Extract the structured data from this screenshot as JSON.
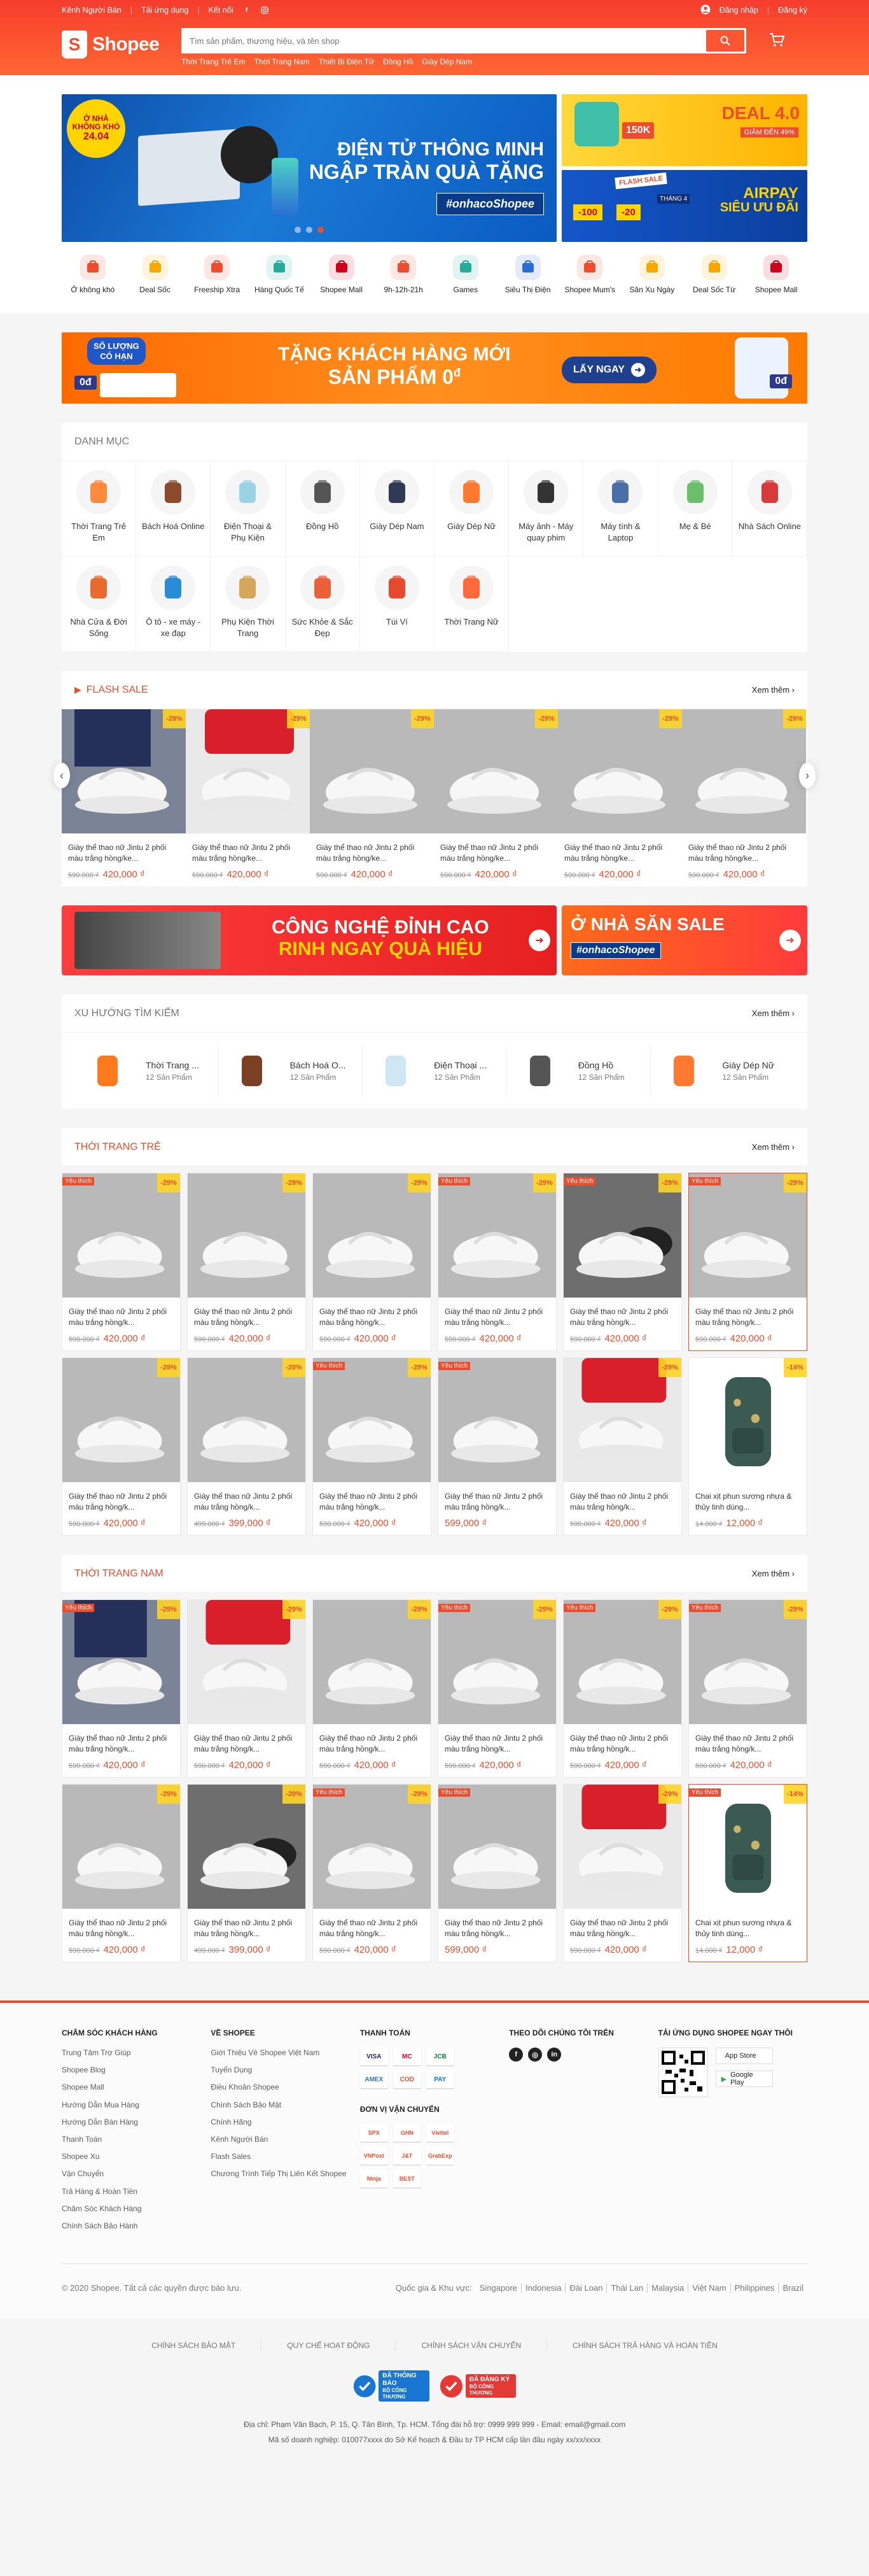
{
  "topbar": {
    "seller": "Kênh Người Bán",
    "download": "Tải ứng dụng",
    "connect": "Kết nối",
    "login": "Đăng nhập",
    "register": "Đăng ký"
  },
  "logo": {
    "text": "Shopee"
  },
  "search": {
    "placeholder": "Tìm sản phẩm, thương hiệu, và tên shop"
  },
  "hotwords": [
    "Thời Trang Trẻ Em",
    "Thời Trang Nam",
    "Thiết Bị Điện Tử",
    "Đồng Hồ",
    "Giày Dép Nam"
  ],
  "banner": {
    "badge_line1": "Ở NHÀ",
    "badge_line2": "KHÔNG KHÓ",
    "badge_date": "24.04",
    "headline1": "ĐIỆN TỬ THÔNG MINH",
    "headline2": "NGẬP TRÀN QUÀ TẶNG",
    "hashtag": "#onhacoShopee",
    "side1_title": "DEAL 4.0",
    "side1_sub": "GIẢM ĐẾN 49%",
    "side1_voucher": "150K",
    "side2_title1": "AIRPAY",
    "side2_title2": "SIÊU ƯU ĐÃI",
    "side2_tag": "THÁNG 4",
    "side2_v1": "-100",
    "side2_v2": "-20",
    "side2_flash": "FLASH SALE"
  },
  "quicklinks": [
    {
      "label": "Ở không khó",
      "icon": "home-icon",
      "color": "#ee4d2d"
    },
    {
      "label": "Deal Sốc",
      "icon": "deal-icon",
      "color": "#f6a700"
    },
    {
      "label": "Freeship Xtra",
      "icon": "truck-icon",
      "color": "#ee4d2d"
    },
    {
      "label": "Hàng Quốc Tế",
      "icon": "globe-icon",
      "color": "#26aa99"
    },
    {
      "label": "Shopee Mall",
      "icon": "mall-icon",
      "color": "#d0011b"
    },
    {
      "label": "9h-12h-21h",
      "icon": "flash-icon",
      "color": "#ee4d2d"
    },
    {
      "label": "Games",
      "icon": "gamepad-icon",
      "color": "#26aa99"
    },
    {
      "label": "Siêu Thị Điện",
      "icon": "monitor-icon",
      "color": "#2b6cd6"
    },
    {
      "label": "Shopee Mum's",
      "icon": "mums-club-icon",
      "color": "#ee4d2d"
    },
    {
      "label": "Săn Xu Ngày",
      "icon": "coin-icon",
      "color": "#f6a700"
    },
    {
      "label": "Deal Sốc Từ",
      "icon": "deal-icon",
      "color": "#f6a700"
    },
    {
      "label": "Shopee Mall",
      "icon": "mall-bag-icon",
      "color": "#d0011b"
    }
  ],
  "promo": {
    "left_label": "SỐ LƯỢNG",
    "left_label2": "CÓ HẠN",
    "price_tag": "0đ",
    "title1": "TẶNG KHÁCH HÀNG MỚI",
    "title2": "SẢN PHẨM 0",
    "title2_sup": "đ",
    "cta": "LẤY NGAY"
  },
  "category": {
    "title": "DANH MỤC",
    "items": [
      {
        "name": "Thời Trang Trẻ Em",
        "icon": "kids-dress-icon",
        "color": "#ff8a3d"
      },
      {
        "name": "Bách Hoá Online",
        "icon": "grocery-icon",
        "color": "#8b4a2b"
      },
      {
        "name": "Điện Thoại & Phụ Kiện",
        "icon": "phone-icon",
        "color": "#9bd3e6"
      },
      {
        "name": "Đồng Hồ",
        "icon": "watch-icon",
        "color": "#555555"
      },
      {
        "name": "Giày Dép Nam",
        "icon": "men-shoe-icon",
        "color": "#2f3a56"
      },
      {
        "name": "Giày Dép Nữ",
        "icon": "high-heel-icon",
        "color": "#ff7a2f"
      },
      {
        "name": "Máy ảnh - Máy quay phim",
        "icon": "camera-icon",
        "color": "#333333"
      },
      {
        "name": "Máy tính & Laptop",
        "icon": "laptop-icon",
        "color": "#4a6ea8"
      },
      {
        "name": "Mẹ & Bé",
        "icon": "baby-icon",
        "color": "#6bbf6b"
      },
      {
        "name": "Nhà Sách Online",
        "icon": "book-icon",
        "color": "#d63a3a"
      },
      {
        "name": "Nhà Cửa & Đời Sống",
        "icon": "pot-icon",
        "color": "#e86a2e"
      },
      {
        "name": "Ô tô - xe máy - xe đạp",
        "icon": "scooter-icon",
        "color": "#2a8bd6"
      },
      {
        "name": "Phụ Kiện Thời Trang",
        "icon": "accessory-icon",
        "color": "#d4a75a"
      },
      {
        "name": "Sức Khỏe & Sắc Đẹp",
        "icon": "beauty-icon",
        "color": "#e9603a"
      },
      {
        "name": "Túi Ví",
        "icon": "bag-icon",
        "color": "#e64a2e"
      },
      {
        "name": "Thời Trang Nữ",
        "icon": "women-top-icon",
        "color": "#ff6a3d"
      }
    ]
  },
  "flash_sale": {
    "title": "FLASH SALE",
    "see_all": "Xem thêm",
    "items": [
      {
        "name": "Giày thể thao nữ Jintu 2 phối màu trắng hồng/ke...",
        "old": "590.000 ₫",
        "new": "420,000 ₫",
        "discount": "-29%",
        "theme": "navy"
      },
      {
        "name": "Giày thể thao nữ Jintu 2 phối màu trắng hồng/ke...",
        "old": "590.000 ₫",
        "new": "420,000 ₫",
        "discount": "-29%",
        "theme": "red"
      },
      {
        "name": "Giày thể thao nữ Jintu 2 phối màu trắng hồng/ke...",
        "old": "590.000 ₫",
        "new": "420,000 ₫",
        "discount": "-29%",
        "theme": "white"
      },
      {
        "name": "Giày thể thao nữ Jintu 2 phối màu trắng hồng/ke...",
        "old": "590.000 ₫",
        "new": "420,000 ₫",
        "discount": "-29%",
        "theme": "white"
      },
      {
        "name": "Giày thể thao nữ Jintu 2 phối màu trắng hồng/ke...",
        "old": "590.000 ₫",
        "new": "420,000 ₫",
        "discount": "-29%",
        "theme": "white"
      },
      {
        "name": "Giày thể thao nữ Jintu 2 phối màu trắng hồng/ke...",
        "old": "590.000 ₫",
        "new": "420,000 ₫",
        "discount": "-29%",
        "theme": "white"
      }
    ]
  },
  "promo2": {
    "left1": "CÔNG NGHỆ ĐỈNH CAO",
    "left2": "RINH NGAY QUÀ HIỆU",
    "right1": "Ở NHÀ SĂN SALE",
    "right2": "#onhacoShopee"
  },
  "trends": {
    "title": "XU HƯỚNG TÌM KIẾM",
    "see_all": "Xem thêm",
    "items": [
      {
        "name": "Thời Trang ...",
        "count": "12 Sản Phẩm",
        "icon": "dress-icon",
        "color": "#ff7a1f"
      },
      {
        "name": "Bách Hoá O...",
        "count": "12 Sản Phẩm",
        "icon": "chocolate-icon",
        "color": "#7b3f24"
      },
      {
        "name": "Điện Thoại ...",
        "count": "12 Sản Phẩm",
        "icon": "phone-icon",
        "color": "#cfe7f2"
      },
      {
        "name": "Đồng Hồ",
        "count": "12 Sản Phẩm",
        "icon": "watch-icon",
        "color": "#555555"
      },
      {
        "name": "Giày Dép Nữ",
        "count": "12 Sản Phẩm",
        "icon": "high-heel-icon",
        "color": "#ff7a2f"
      }
    ]
  },
  "women": {
    "title": "THỜI TRANG TRẺ",
    "see_all": "Xem thêm",
    "items": [
      {
        "name": "Giày thể thao nữ Jintu 2 phối màu trắng hồng/k...",
        "old": "590.000 ₫",
        "new": "420,000 ₫",
        "discount": "-29%",
        "theme": "white",
        "fav": "Yêu thích"
      },
      {
        "name": "Giày thể thao nữ Jintu 2 phối màu trắng hồng/k...",
        "old": "590.000 ₫",
        "new": "420,000 ₫",
        "discount": "-29%",
        "theme": "white",
        "fav": ""
      },
      {
        "name": "Giày thể thao nữ Jintu 2 phối màu trắng hồng/k...",
        "old": "590.000 ₫",
        "new": "420,000 ₫",
        "discount": "-29%",
        "theme": "white",
        "fav": ""
      },
      {
        "name": "Giày thể thao nữ Jintu 2 phối màu trắng hồng/k...",
        "old": "590.000 ₫",
        "new": "420,000 ₫",
        "discount": "-29%",
        "theme": "white",
        "fav": "Yêu thích"
      },
      {
        "name": "Giày thể thao nữ Jintu 2 phối màu trắng hồng/k...",
        "old": "590.000 ₫",
        "new": "420,000 ₫",
        "discount": "-29%",
        "theme": "black",
        "fav": "Yêu thích"
      },
      {
        "name": "Giày thể thao nữ Jintu 2 phối màu trắng hồng/k...",
        "old": "590.000 ₫",
        "new": "420,000 ₫",
        "discount": "-29%",
        "theme": "white",
        "fav": "Yêu thích"
      },
      {
        "name": "Giày thể thao nữ Jintu 2 phối màu trắng hồng/k...",
        "old": "590.000 ₫",
        "new": "420,000 ₫",
        "discount": "-29%",
        "theme": "white",
        "fav": ""
      },
      {
        "name": "Giày thể thao nữ Jintu 2 phối màu trắng hồng/k...",
        "old": "499.000 ₫",
        "new": "399,000 ₫",
        "discount": "-20%",
        "theme": "white",
        "fav": ""
      },
      {
        "name": "Giày thể thao nữ Jintu 2 phối màu trắng hồng/k...",
        "old": "590.000 ₫",
        "new": "420,000 ₫",
        "discount": "-29%",
        "theme": "white",
        "fav": "Yêu thích"
      },
      {
        "name": "Giày thể thao nữ Jintu 2 phối màu trắng hồng/k...",
        "old": "",
        "new": "599,000 ₫",
        "discount": "",
        "theme": "white",
        "fav": "Yêu thích"
      },
      {
        "name": "Giày thể thao nữ Jintu 2 phối màu trắng hồng/k...",
        "old": "590.000 ₫",
        "new": "420,000 ₫",
        "discount": "-29%",
        "theme": "red",
        "fav": ""
      },
      {
        "name": "Chai xịt phun sương nhựa & thủy tinh dùng...",
        "old": "14.000 ₫",
        "new": "12,000 ₫",
        "discount": "-14%",
        "theme": "backpack",
        "fav": ""
      }
    ]
  },
  "men": {
    "title": "THỜI TRANG NAM",
    "see_all": "Xem thêm",
    "items": [
      {
        "name": "Giày thể thao nữ Jintu 2 phối màu trắng hồng/k...",
        "old": "590.000 ₫",
        "new": "420,000 ₫",
        "discount": "-29%",
        "theme": "navy",
        "fav": "Yêu thích"
      },
      {
        "name": "Giày thể thao nữ Jintu 2 phối màu trắng hồng/k...",
        "old": "590.000 ₫",
        "new": "420,000 ₫",
        "discount": "-29%",
        "theme": "red",
        "fav": ""
      },
      {
        "name": "Giày thể thao nữ Jintu 2 phối màu trắng hồng/k...",
        "old": "590.000 ₫",
        "new": "420,000 ₫",
        "discount": "-29%",
        "theme": "white",
        "fav": ""
      },
      {
        "name": "Giày thể thao nữ Jintu 2 phối màu trắng hồng/k...",
        "old": "590.000 ₫",
        "new": "420,000 ₫",
        "discount": "-29%",
        "theme": "white",
        "fav": "Yêu thích"
      },
      {
        "name": "Giày thể thao nữ Jintu 2 phối màu trắng hồng/k...",
        "old": "590.000 ₫",
        "new": "420,000 ₫",
        "discount": "-29%",
        "theme": "white",
        "fav": "Yêu thích"
      },
      {
        "name": "Giày thể thao nữ Jintu 2 phối màu trắng hồng/k...",
        "old": "590.000 ₫",
        "new": "420,000 ₫",
        "discount": "-29%",
        "theme": "white",
        "fav": "Yêu thích"
      },
      {
        "name": "Giày thể thao nữ Jintu 2 phối màu trắng hồng/k...",
        "old": "590.000 ₫",
        "new": "420,000 ₫",
        "discount": "-29%",
        "theme": "white",
        "fav": ""
      },
      {
        "name": "Giày thể thao nữ Jintu 2 phối màu trắng hồng/k...",
        "old": "499.000 ₫",
        "new": "399,000 ₫",
        "discount": "-20%",
        "theme": "black",
        "fav": ""
      },
      {
        "name": "Giày thể thao nữ Jintu 2 phối màu trắng hồng/k...",
        "old": "590.000 ₫",
        "new": "420,000 ₫",
        "discount": "-29%",
        "theme": "white",
        "fav": "Yêu thích"
      },
      {
        "name": "Giày thể thao nữ Jintu 2 phối màu trắng hồng/k...",
        "old": "",
        "new": "599,000 ₫",
        "discount": "",
        "theme": "white",
        "fav": "Yêu thích"
      },
      {
        "name": "Giày thể thao nữ Jintu 2 phối màu trắng hồng/k...",
        "old": "590.000 ₫",
        "new": "420,000 ₫",
        "discount": "-29%",
        "theme": "red",
        "fav": ""
      },
      {
        "name": "Chai xịt phun sương nhựa & thủy tinh dùng...",
        "old": "14.000 ₫",
        "new": "12,000 ₫",
        "discount": "-14%",
        "theme": "backpack",
        "fav": "Yêu thích"
      }
    ]
  },
  "footer": {
    "col1_title": "CHĂM SÓC KHÁCH HÀNG",
    "col1": [
      "Trung Tâm Trợ Giúp",
      "Shopee Blog",
      "Shopee Mall",
      "Hướng Dẫn Mua Hàng",
      "Hướng Dẫn Bán Hàng",
      "Thanh Toán",
      "Shopee Xu",
      "Vận Chuyển",
      "Trả Hàng & Hoàn Tiền",
      "Chăm Sóc Khách Hàng",
      "Chính Sách Bảo Hành"
    ],
    "col2_title": "VỀ SHOPEE",
    "col2": [
      "Giới Thiệu Về Shopee Việt Nam",
      "Tuyển Dụng",
      "Điều Khoản Shopee",
      "Chính Sách Bảo Mật",
      "Chính Hãng",
      "Kênh Người Bán",
      "Flash Sales",
      "Chương Trình Tiếp Thị Liên Kết Shopee"
    ],
    "col3_title": "THANH TOÁN",
    "pay": [
      "VISA",
      "MC",
      "JCB",
      "AMEX",
      "COD",
      "PAY"
    ],
    "ship_title": "ĐƠN VỊ VẬN CHUYỂN",
    "ship": [
      "SPX",
      "GHN",
      "Viettel",
      "VNPost",
      "J&T",
      "GrabExp",
      "Ninja",
      "BEST"
    ],
    "col4_title": "THEO DÕI CHÚNG TÔI TRÊN",
    "col5_title": "TẢI ỨNG DỤNG SHOPEE NGAY THÔI",
    "appstore": "App Store",
    "googleplay": "Google Play",
    "copyright": "© 2020 Shopee. Tất cả các quyền được bảo lưu.",
    "country_label": "Quốc gia & Khu vực:",
    "countries": [
      "Singapore",
      "Indonesia",
      "Đài Loan",
      "Thái Lan",
      "Malaysia",
      "Việt Nam",
      "Philippines",
      "Brazil"
    ],
    "policies": [
      "CHÍNH SÁCH BẢO MẬT",
      "QUY CHẾ HOẠT ĐỘNG",
      "CHÍNH SÁCH VẬN CHUYỂN",
      "CHÍNH SÁCH TRẢ HÀNG VÀ HOÀN TIỀN"
    ],
    "cert1": "ĐÃ THÔNG BÁO",
    "cert1_sub": "BỘ CÔNG THƯƠNG",
    "cert2": "ĐÃ ĐĂNG KÝ",
    "cert2_sub": "BỘ CÔNG THƯƠNG",
    "addr1": "Địa chỉ: Phạm Văn Bạch, P. 15, Q. Tân Bình, Tp. HCM. Tổng đài hỗ trợ: 0999 999 999 - Email: email@gmail.com",
    "addr2": "Mã số doanh nghiệp: 010077xxxx do Sở Kế hoạch & Đầu tư TP HCM cấp lần đầu ngày xx/xx/xxxx"
  }
}
